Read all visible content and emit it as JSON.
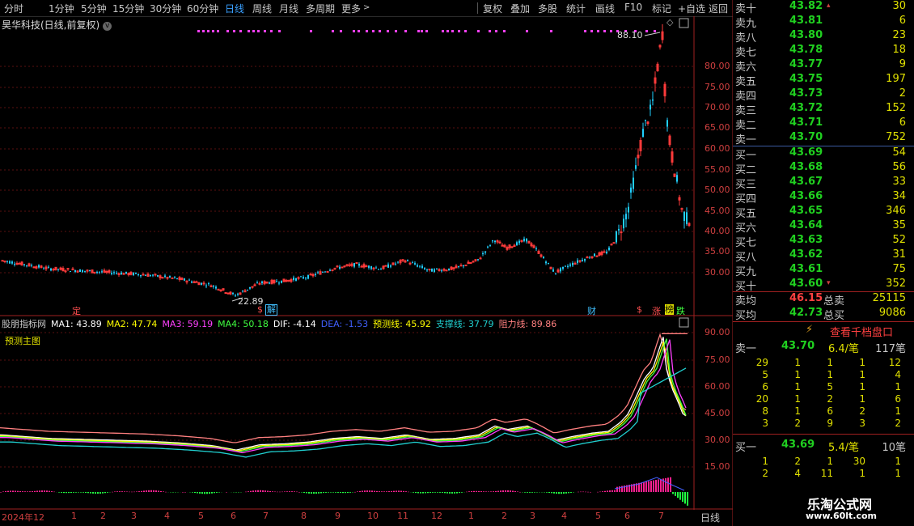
{
  "toolbar": {
    "periods": [
      "分时",
      "1分钟",
      "5分钟",
      "15分钟",
      "30分钟",
      "60分钟",
      "日线",
      "周线",
      "月线",
      "多周期",
      "更多"
    ],
    "active_period": "日线",
    "tools": [
      "复权",
      "叠加",
      "多股",
      "统计",
      "画线",
      "F10",
      "标记",
      "+自选",
      "返回"
    ]
  },
  "stock": {
    "title": "昊华科技(日线,前复权)",
    "high_label": "88.10",
    "low_label": "22.89",
    "yaxis": [
      "80.00",
      "75.00",
      "70.00",
      "65.00",
      "60.00",
      "55.00",
      "50.00",
      "45.00",
      "40.00",
      "35.00",
      "30.00"
    ],
    "markers": {
      "ding": "定",
      "s1": "$",
      "jie": "解",
      "cai": "财",
      "s2": "$",
      "zhang": "涨",
      "bang": "榜",
      "die": "跌"
    }
  },
  "indicator": {
    "name": "股朋指标网",
    "ma1": "MA1: 43.89",
    "ma2": "MA2: 47.74",
    "ma3": "MA3: 59.19",
    "ma4": "MA4: 50.18",
    "dif": "DIF: -4.14",
    "dea": "DEA: -1.53",
    "yuce": "预测线: 45.92",
    "zhicheng": "支撑线: 37.79",
    "zuli": "阻力线: 89.86",
    "subtitle": "预测主图",
    "yaxis": [
      "90.00",
      "75.00",
      "60.00",
      "45.00",
      "30.00",
      "15.00"
    ]
  },
  "dates": {
    "labels": [
      "2024年12",
      "1",
      "2",
      "3",
      "4",
      "5",
      "6",
      "7",
      "8",
      "9",
      "10",
      "11",
      "12",
      "1",
      "2",
      "3",
      "4",
      "5",
      "6",
      "7"
    ],
    "period_label": "日线"
  },
  "orderbook": {
    "sell": [
      {
        "label": "卖十",
        "price": "43.82",
        "vol": "30"
      },
      {
        "label": "卖九",
        "price": "43.81",
        "vol": "6"
      },
      {
        "label": "卖八",
        "price": "43.80",
        "vol": "23"
      },
      {
        "label": "卖七",
        "price": "43.78",
        "vol": "18"
      },
      {
        "label": "卖六",
        "price": "43.77",
        "vol": "9"
      },
      {
        "label": "卖五",
        "price": "43.75",
        "vol": "197"
      },
      {
        "label": "卖四",
        "price": "43.73",
        "vol": "2"
      },
      {
        "label": "卖三",
        "price": "43.72",
        "vol": "152"
      },
      {
        "label": "卖二",
        "price": "43.71",
        "vol": "6"
      },
      {
        "label": "卖一",
        "price": "43.70",
        "vol": "752"
      }
    ],
    "buy": [
      {
        "label": "买一",
        "price": "43.69",
        "vol": "54"
      },
      {
        "label": "买二",
        "price": "43.68",
        "vol": "56"
      },
      {
        "label": "买三",
        "price": "43.67",
        "vol": "33"
      },
      {
        "label": "买四",
        "price": "43.66",
        "vol": "34"
      },
      {
        "label": "买五",
        "price": "43.65",
        "vol": "346"
      },
      {
        "label": "买六",
        "price": "43.64",
        "vol": "35"
      },
      {
        "label": "买七",
        "price": "43.63",
        "vol": "52"
      },
      {
        "label": "买八",
        "price": "43.62",
        "vol": "31"
      },
      {
        "label": "买九",
        "price": "43.61",
        "vol": "75"
      },
      {
        "label": "买十",
        "price": "43.60",
        "vol": "352"
      }
    ],
    "sell_avg_label": "卖均",
    "sell_avg": "46.15",
    "sell_total_label": "总卖",
    "sell_total": "25115",
    "buy_avg_label": "买均",
    "buy_avg": "42.73",
    "buy_total_label": "总买",
    "buy_total": "9086",
    "queue_button": "查看千档盘口",
    "sell1": {
      "label": "卖一",
      "price": "43.70",
      "per": "6.4/笔",
      "count": "117笔"
    },
    "sell_queue": [
      [
        "29",
        "1",
        "1",
        "1",
        "12"
      ],
      [
        "5",
        "1",
        "1",
        "1",
        "4"
      ],
      [
        "6",
        "1",
        "5",
        "1",
        "1"
      ],
      [
        "20",
        "1",
        "2",
        "1",
        "6"
      ],
      [
        "8",
        "1",
        "6",
        "2",
        "1"
      ],
      [
        "3",
        "2",
        "9",
        "3",
        "2"
      ]
    ],
    "buy1": {
      "label": "买一",
      "price": "43.69",
      "per": "5.4/笔",
      "count": "10笔"
    },
    "buy_queue": [
      [
        "1",
        "2",
        "1",
        "30",
        "1"
      ],
      [
        "2",
        "4",
        "11",
        "1",
        "1"
      ]
    ]
  },
  "watermark": {
    "line1": "乐淘公式网",
    "line2": "www.60lt.com"
  },
  "colors": {
    "up": "#ff3a3a",
    "down": "#20d0ff",
    "grid": "#5a1010",
    "price_green": "#20d020",
    "volume_yellow": "#e0e000"
  }
}
